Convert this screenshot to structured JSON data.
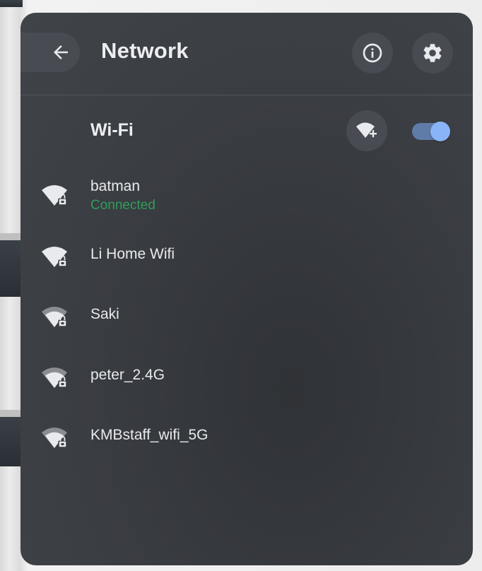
{
  "header": {
    "title": "Network"
  },
  "wifi": {
    "label": "Wi-Fi",
    "enabled": true
  },
  "networks": [
    {
      "name": "batman",
      "status": "Connected",
      "signal": "full",
      "secured": true
    },
    {
      "name": "Li Home Wifi",
      "signal": "full",
      "secured": true
    },
    {
      "name": "Saki",
      "signal": "partial",
      "secured": true
    },
    {
      "name": "peter_2.4G",
      "signal": "partial",
      "secured": true
    },
    {
      "name": "KMBstaff_wifi_5G",
      "signal": "partial",
      "secured": true
    }
  ],
  "colors": {
    "panel": "#3a3d42",
    "connected": "#2f9e5a",
    "toggle_track": "#5f7ca8",
    "toggle_knob": "#8ab4f8"
  },
  "icons": {
    "back": "arrow-left-icon",
    "info": "info-icon",
    "settings": "gear-icon",
    "add_network": "wifi-add-icon",
    "network": "wifi-lock-icon"
  }
}
